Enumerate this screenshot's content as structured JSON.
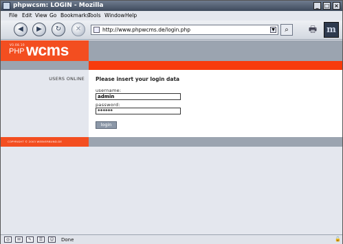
{
  "window": {
    "title": "phpwcsm: LOGIN - Mozilla",
    "controls": [
      "_",
      "□",
      "×"
    ]
  },
  "menu": {
    "file": "File",
    "edit": "Edit",
    "view": "View",
    "go": "Go",
    "bookmarks": "Bookmarks",
    "tools": "Tools",
    "window": "Window",
    "help": "Help"
  },
  "toolbar": {
    "url": "http://www.phpwcms.de/login.php",
    "back_glyph": "◀",
    "forward_glyph": "▶",
    "reload_glyph": "↻",
    "stop_glyph": "✕",
    "search_glyph": "⌕",
    "print_glyph": "🖶",
    "throbber_glyph": "m"
  },
  "page": {
    "logo": {
      "version": "V0.08.10",
      "php": "PHP",
      "wcms": "wcms"
    },
    "sidebar": {
      "users_online": "USERS ONLINE"
    },
    "login": {
      "heading": "Please insert your login data",
      "username_label": "username:",
      "username_value": "admin",
      "password_label": "password:",
      "password_value": "******",
      "button": "login"
    },
    "footer": {
      "copyright": "COPYRIGHT © 2003 WEBVERBUND.DE"
    }
  },
  "status": {
    "text": "Done"
  },
  "icons": {
    "statusbar": [
      "navigator-icon",
      "mail-icon",
      "composer-icon",
      "addressbook-icon",
      "chat-icon"
    ],
    "lock": "lock-icon"
  },
  "colors": {
    "accent": "#f34e20",
    "header_gray": "#9ba4b0",
    "stripe_red": "#f73b0d"
  }
}
